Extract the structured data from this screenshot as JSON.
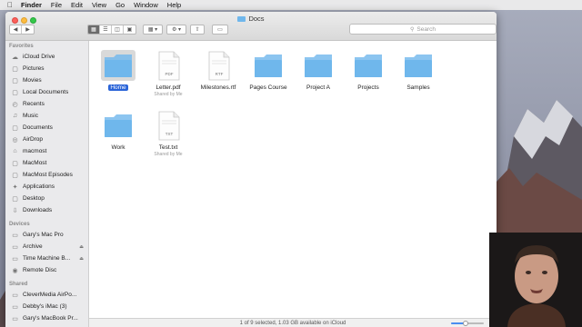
{
  "menubar": {
    "items": [
      "Finder",
      "File",
      "Edit",
      "View",
      "Go",
      "Window",
      "Help"
    ]
  },
  "window": {
    "title": "Docs",
    "search_placeholder": "Search"
  },
  "sidebar": {
    "favorites_header": "Favorites",
    "favorites": [
      {
        "label": "iCloud Drive",
        "icon": "cloud-icon"
      },
      {
        "label": "Pictures",
        "icon": "folder-icon"
      },
      {
        "label": "Movies",
        "icon": "folder-icon"
      },
      {
        "label": "Local Documents",
        "icon": "folder-icon"
      },
      {
        "label": "Recents",
        "icon": "clock-icon"
      },
      {
        "label": "Music",
        "icon": "music-icon"
      },
      {
        "label": "Documents",
        "icon": "folder-icon"
      },
      {
        "label": "AirDrop",
        "icon": "airdrop-icon"
      },
      {
        "label": "macmost",
        "icon": "home-icon"
      },
      {
        "label": "MacMost",
        "icon": "folder-icon"
      },
      {
        "label": "MacMost Episodes",
        "icon": "folder-icon"
      },
      {
        "label": "Applications",
        "icon": "applications-icon"
      },
      {
        "label": "Desktop",
        "icon": "folder-icon"
      },
      {
        "label": "Downloads",
        "icon": "download-icon"
      }
    ],
    "devices_header": "Devices",
    "devices": [
      {
        "label": "Gary's Mac Pro",
        "icon": "computer-icon",
        "eject": false
      },
      {
        "label": "Archive",
        "icon": "drive-icon",
        "eject": true
      },
      {
        "label": "Time Machine B...",
        "icon": "drive-icon",
        "eject": true
      },
      {
        "label": "Remote Disc",
        "icon": "disc-icon",
        "eject": false
      }
    ],
    "shared_header": "Shared",
    "shared": [
      {
        "label": "CleverMedia AirPo...",
        "icon": "computer-icon"
      },
      {
        "label": "Debby's iMac (3)",
        "icon": "computer-icon"
      },
      {
        "label": "Gary's MacBook Pr...",
        "icon": "computer-icon"
      }
    ]
  },
  "files": [
    {
      "name": "Home",
      "kind": "folder",
      "selected": true,
      "sub": ""
    },
    {
      "name": "Letter.pdf",
      "kind": "document",
      "badge": "PDF",
      "selected": false,
      "sub": "Shared by Me"
    },
    {
      "name": "Milestones.rtf",
      "kind": "document",
      "badge": "RTF",
      "selected": false,
      "sub": ""
    },
    {
      "name": "Pages Course",
      "kind": "folder",
      "selected": false,
      "sub": ""
    },
    {
      "name": "Project A",
      "kind": "folder",
      "selected": false,
      "sub": ""
    },
    {
      "name": "Projects",
      "kind": "folder",
      "selected": false,
      "sub": ""
    },
    {
      "name": "Samples",
      "kind": "folder",
      "selected": false,
      "sub": ""
    },
    {
      "name": "Work",
      "kind": "folder",
      "selected": false,
      "sub": ""
    },
    {
      "name": "Test.txt",
      "kind": "document",
      "badge": "TXT",
      "selected": false,
      "sub": "Shared by Me"
    }
  ],
  "statusbar": {
    "text": "1 of 9 selected, 1.03 GB available on iCloud",
    "icon_size_fraction": 0.45
  },
  "colors": {
    "folder": "#6fb7ec",
    "selection": "#2a64d8",
    "sidebar_bg": "#eaeaec"
  }
}
